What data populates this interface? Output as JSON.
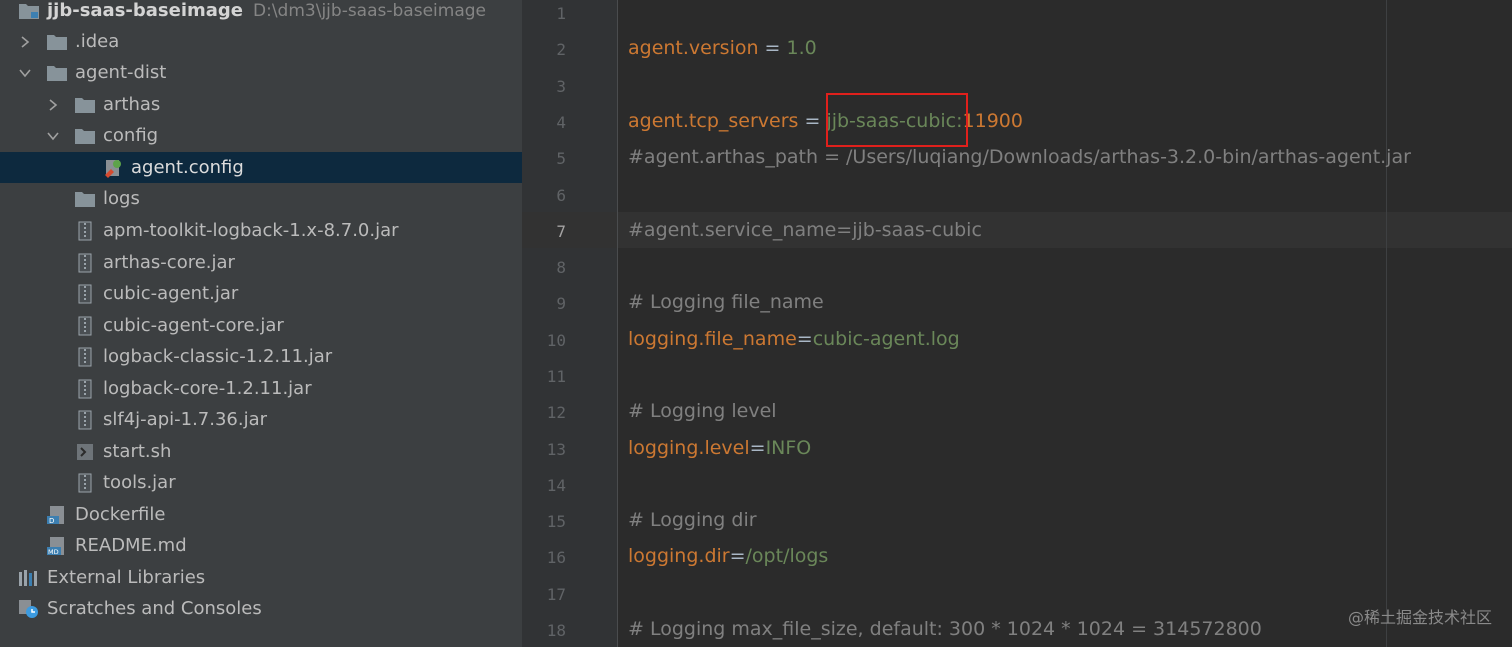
{
  "project_tree": {
    "root": {
      "name": "jjb-saas-baseimage",
      "path": "D:\\dm3\\jjb-saas-baseimage"
    },
    "items": [
      {
        "label": ".idea"
      },
      {
        "label": "agent-dist"
      },
      {
        "label": "arthas"
      },
      {
        "label": "config"
      },
      {
        "label": "agent.config",
        "selected": true
      },
      {
        "label": "logs"
      },
      {
        "label": "apm-toolkit-logback-1.x-8.7.0.jar"
      },
      {
        "label": "arthas-core.jar"
      },
      {
        "label": "cubic-agent.jar"
      },
      {
        "label": "cubic-agent-core.jar"
      },
      {
        "label": "logback-classic-1.2.11.jar"
      },
      {
        "label": "logback-core-1.2.11.jar"
      },
      {
        "label": "slf4j-api-1.7.36.jar"
      },
      {
        "label": "start.sh"
      },
      {
        "label": "tools.jar"
      },
      {
        "label": "Dockerfile"
      },
      {
        "label": "README.md"
      },
      {
        "label": "External Libraries"
      },
      {
        "label": "Scratches and Consoles"
      }
    ]
  },
  "editor": {
    "current_line": 7,
    "line_numbers": [
      "1",
      "2",
      "3",
      "4",
      "5",
      "6",
      "7",
      "8",
      "9",
      "10",
      "11",
      "12",
      "13",
      "14",
      "15",
      "16",
      "17",
      "18"
    ],
    "lines": {
      "l2": {
        "key": "agent.version",
        "eq": " = ",
        "val": "1.0"
      },
      "l4": {
        "key": "agent.tcp_servers",
        "eq": " = ",
        "val": "jjb-saas-cubic",
        "sep": ":",
        "port": "11900"
      },
      "l5": {
        "comment": "#agent.arthas_path = /Users/luqiang/Downloads/arthas-3.2.0-bin/arthas-agent.jar"
      },
      "l7": {
        "comment": "#agent.service_name=jjb-saas-cubic"
      },
      "l9": {
        "comment": "# Logging file_name"
      },
      "l10": {
        "key": "logging.file_name",
        "eq": "=",
        "val": "cubic-agent.log"
      },
      "l12": {
        "comment": "# Logging level"
      },
      "l13": {
        "key": "logging.level",
        "eq": "=",
        "val": "INFO"
      },
      "l15": {
        "comment": "# Logging dir"
      },
      "l16": {
        "key": "logging.dir",
        "eq": "=",
        "val": "/opt/logs"
      },
      "l18": {
        "comment": "# Logging max_file_size, default: 300 * 1024 * 1024 = 314572800"
      }
    }
  },
  "watermark": "@稀土掘金技术社区",
  "colors": {
    "key": "#cc7832",
    "value": "#6a8759",
    "comment": "#808080",
    "highlight_box": "#e0201c",
    "selection": "#0d293e"
  },
  "icons": [
    "folder-icon",
    "chevron-right-icon",
    "chevron-down-icon",
    "config-file-icon",
    "jar-icon",
    "shell-script-icon",
    "docker-file-icon",
    "markdown-file-icon",
    "libraries-icon",
    "scratches-icon"
  ]
}
